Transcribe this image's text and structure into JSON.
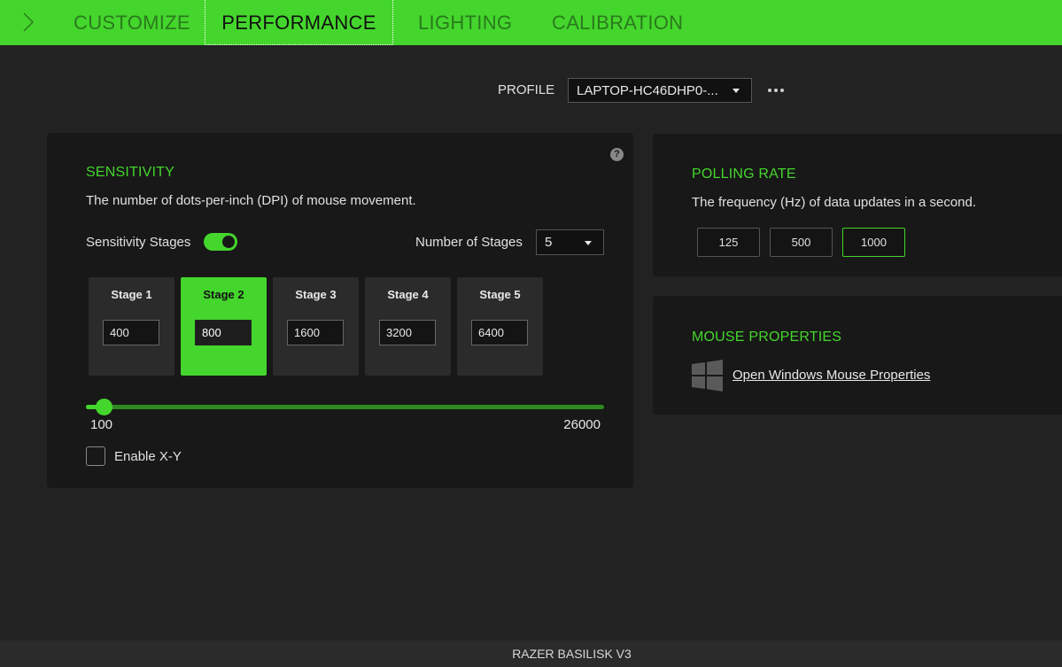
{
  "tabs": [
    {
      "label": "CUSTOMIZE"
    },
    {
      "label": "PERFORMANCE"
    },
    {
      "label": "LIGHTING"
    },
    {
      "label": "CALIBRATION"
    }
  ],
  "active_tab": "PERFORMANCE",
  "profile": {
    "label": "PROFILE",
    "value": "LAPTOP-HC46DHP0-...",
    "more_icon": "more-dots-icon"
  },
  "sensitivity": {
    "title": "SENSITIVITY",
    "description": "The number of dots-per-inch (DPI) of mouse movement.",
    "help_icon": "?",
    "stages_label": "Sensitivity Stages",
    "stages_enabled": true,
    "num_stages_label": "Number of Stages",
    "num_stages_value": "5",
    "stages": [
      {
        "name": "Stage 1",
        "dpi": "400"
      },
      {
        "name": "Stage 2",
        "dpi": "800"
      },
      {
        "name": "Stage 3",
        "dpi": "1600"
      },
      {
        "name": "Stage 4",
        "dpi": "3200"
      },
      {
        "name": "Stage 5",
        "dpi": "6400"
      }
    ],
    "active_stage": 1,
    "slider_min": "100",
    "slider_max": "26000",
    "slider_value": 800,
    "enable_xy_label": "Enable X-Y",
    "enable_xy_checked": false
  },
  "polling": {
    "title": "POLLING RATE",
    "description": "The frequency (Hz) of data updates in a second.",
    "options": [
      "125",
      "500",
      "1000"
    ],
    "selected": "1000"
  },
  "mouse_properties": {
    "title": "MOUSE PROPERTIES",
    "link_label": "Open Windows Mouse Properties",
    "icon": "windows-logo-icon"
  },
  "footer": {
    "device_name": "RAZER BASILISK V3"
  },
  "colors": {
    "accent": "#44d62c",
    "background": "#222222",
    "panel": "#181818"
  }
}
